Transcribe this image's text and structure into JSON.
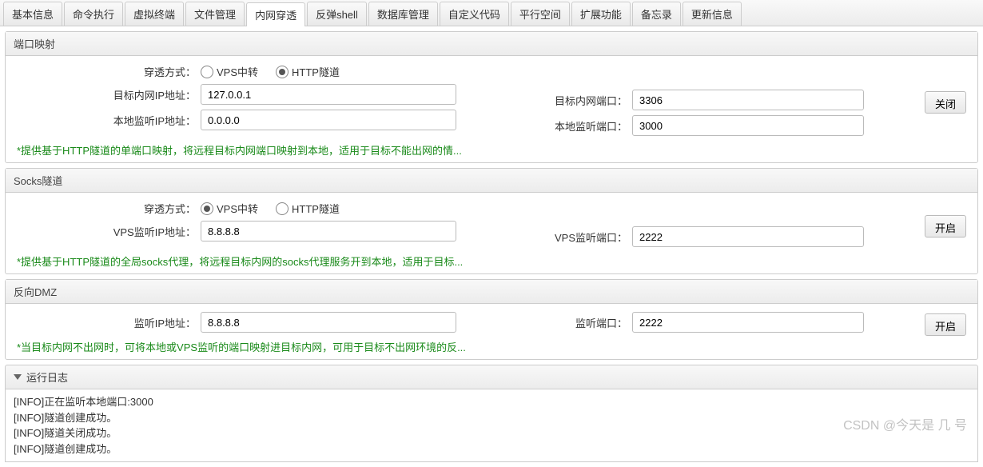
{
  "tabs": [
    "基本信息",
    "命令执行",
    "虚拟终端",
    "文件管理",
    "内网穿透",
    "反弹shell",
    "数据库管理",
    "自定义代码",
    "平行空间",
    "扩展功能",
    "备忘录",
    "更新信息"
  ],
  "active_tab_index": 4,
  "port_mapping": {
    "title": "端口映射",
    "method_label": "穿透方式：",
    "method_options": [
      "VPS中转",
      "HTTP隧道"
    ],
    "method_selected": 1,
    "target_ip_label": "目标内网IP地址：",
    "target_ip_value": "127.0.0.1",
    "local_ip_label": "本地监听IP地址：",
    "local_ip_value": "0.0.0.0",
    "target_port_label": "目标内网端口：",
    "target_port_value": "3306",
    "local_port_label": "本地监听端口：",
    "local_port_value": "3000",
    "button": "关闭",
    "note": "*提供基于HTTP隧道的单端口映射，将远程目标内网端口映射到本地，适用于目标不能出网的情..."
  },
  "socks": {
    "title": "Socks隧道",
    "method_label": "穿透方式：",
    "method_options": [
      "VPS中转",
      "HTTP隧道"
    ],
    "method_selected": 0,
    "vps_ip_label": "VPS监听IP地址：",
    "vps_ip_value": "8.8.8.8",
    "vps_port_label": "VPS监听端口：",
    "vps_port_value": "2222",
    "button": "开启",
    "note": "*提供基于HTTP隧道的全局socks代理，将远程目标内网的socks代理服务开到本地，适用于目标..."
  },
  "dmz": {
    "title": "反向DMZ",
    "ip_label": "监听IP地址：",
    "ip_value": "8.8.8.8",
    "port_label": "监听端口：",
    "port_value": "2222",
    "button": "开启",
    "note": "*当目标内网不出网时，可将本地或VPS监听的端口映射进目标内网，可用于目标不出网环境的反..."
  },
  "log": {
    "title": "运行日志",
    "lines": [
      "[INFO]正在监听本地端口:3000",
      "[INFO]隧道创建成功。",
      "[INFO]隧道关闭成功。",
      "[INFO]隧道创建成功。"
    ]
  },
  "watermark": "CSDN @今天是 几 号"
}
